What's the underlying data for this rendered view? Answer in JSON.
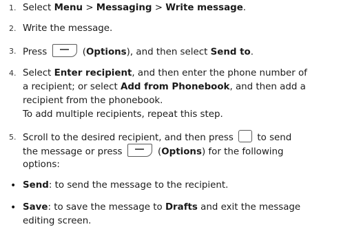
{
  "steps": [
    {
      "num": "1.",
      "t1": "Select ",
      "b1": "Menu",
      "t2": " > ",
      "b2": "Messaging",
      "t3": " > ",
      "b3": "Write message",
      "t4": "."
    },
    {
      "num": "2.",
      "t1": "Write the message."
    },
    {
      "num": "3.",
      "t1": "Press ",
      "t2": " (",
      "b1": "Options",
      "t3": "), and then select ",
      "b2": "Send to",
      "t4": ".",
      "icon": "options-softkey-icon"
    },
    {
      "num": "4.",
      "l1": {
        "t1": "Select ",
        "b1": "Enter recipient",
        "t2": ", and then enter the phone number of"
      },
      "l2": {
        "t1": "a recipient; or select ",
        "b1": "Add from Phonebook",
        "t2": ", and then add a"
      },
      "l3": "recipient from the phonebook.",
      "l4": "To add multiple recipients, repeat this step."
    },
    {
      "num": "5.",
      "l1": {
        "t1": "Scroll to the desired recipient, and then press ",
        "t2": " to send",
        "icon": "confirm-softkey-icon"
      },
      "l2": {
        "t1": "the message or press ",
        "t2": " (",
        "b1": "Options",
        "t3": ") for the following",
        "icon": "options-softkey-icon"
      },
      "l3": "options:"
    }
  ],
  "bullets": [
    {
      "marker": "•",
      "b1": "Send",
      "t1": ": to send the message to the recipient."
    },
    {
      "marker": "•",
      "b1": "Save",
      "t1": ": to save the message to ",
      "b2": "Drafts",
      "t2": " and exit the message",
      "l2": "editing screen."
    }
  ]
}
